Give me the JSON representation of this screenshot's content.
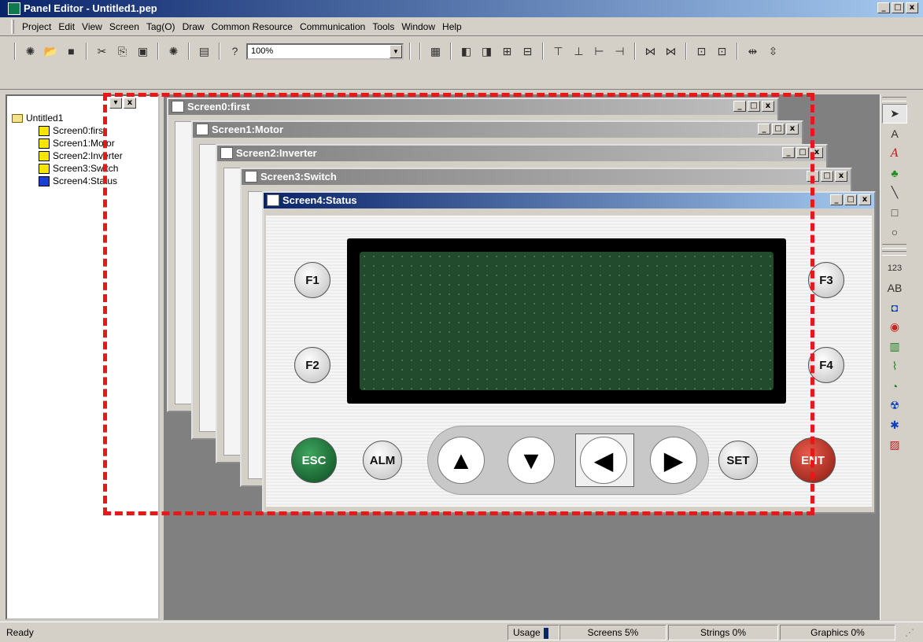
{
  "app": {
    "title": "Panel Editor - Untitled1.pep",
    "window_buttons": [
      "_",
      "□",
      "x"
    ]
  },
  "menu": [
    "Project",
    "Edit",
    "View",
    "Screen",
    "Tag(O)",
    "Draw",
    "Common Resource",
    "Communication",
    "Tools",
    "Window",
    "Help"
  ],
  "toolbar": {
    "zoom_value": "100%",
    "icons": [
      "new-icon",
      "open-icon",
      "save-icon",
      "cut-icon",
      "copy-icon",
      "paste-icon",
      "new-screen-icon",
      "print-icon",
      "help-icon"
    ]
  },
  "tree": {
    "root": "Untitled1",
    "items": [
      "Screen0:first",
      "Screen1:Motor",
      "Screen2:Inverter",
      "Screen3:Switch",
      "Screen4:Status"
    ]
  },
  "windows": [
    {
      "title": "Screen0:first"
    },
    {
      "title": "Screen1:Motor"
    },
    {
      "title": "Screen2:Inverter"
    },
    {
      "title": "Screen3:Switch"
    },
    {
      "title": "Screen4:Status"
    }
  ],
  "panel": {
    "keys": {
      "f1": "F1",
      "f2": "F2",
      "f3": "F3",
      "f4": "F4",
      "esc": "ESC",
      "alm": "ALM",
      "set": "SET",
      "ent": "ENT",
      "up": "▲",
      "down": "▼",
      "left": "◀",
      "right": "▶"
    }
  },
  "right_tools": {
    "text_a": "A",
    "text_a_italic": "A",
    "num_display": "123",
    "ab": "AB"
  },
  "status": {
    "left": "Ready",
    "usage": "Usage",
    "screens": "Screens  5%",
    "strings": "Strings  0%",
    "graphics": "Graphics  0%"
  },
  "colors": {
    "lcd_green": "#224a2c",
    "esc_green": "#0b4a20",
    "ent_red": "#8a1a10",
    "highlight_dash": "#e81818"
  }
}
